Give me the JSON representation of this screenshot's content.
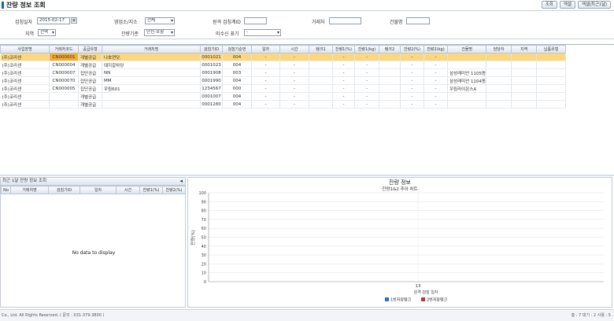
{
  "header": {
    "title": "잔량 정보 조회",
    "buttons": [
      "조회",
      "엑셀",
      "엑셀(최근1달)"
    ]
  },
  "filters": {
    "date_label": "검침일자",
    "date_value": "2015-02-17",
    "office_label": "영업소/지소",
    "office_value": "전체",
    "meter_label": "원격 검침계ID",
    "meter_value": "",
    "client_label": "거래처",
    "client_value": "",
    "building_label": "건물명",
    "building_value": "",
    "region_label": "지역",
    "region_value": "전역",
    "remain_label": "잔량기준",
    "remain_value": "단선-포함",
    "unreceived_label": "미수신 표기",
    "unreceived_value": "-"
  },
  "main_grid": {
    "columns": [
      "사업장명",
      "거래처코드",
      "공급유형",
      "거래처명",
      "검침기ID",
      "검침기순번",
      "일자",
      "시간",
      "탱크1",
      "잔량1(%)",
      "잔량1(kg)",
      "탱크2",
      "잔량2(%)",
      "잔량2(kg)",
      "건물명",
      "담당자",
      "지역",
      "납품유형"
    ],
    "rows": [
      [
        "(주)코리센",
        "CN000001",
        "개별공급",
        "나호연닷.",
        "0001021",
        "004",
        "-",
        "-",
        "",
        "-",
        "-",
        "",
        "-",
        "-",
        "",
        "",
        "",
        ""
      ],
      [
        "(주)코리센",
        "CN000004",
        "개별공급",
        "돼지갈차당",
        "0001023",
        "004",
        "-",
        "-",
        "",
        "-",
        "-",
        "",
        "-",
        "-",
        "",
        "",
        "",
        ""
      ],
      [
        "(주)코리센",
        "CN000007",
        "집단공급",
        "NN",
        "0001908",
        "003",
        "-",
        "-",
        "",
        "-",
        "-",
        "",
        "-",
        "-",
        "삼성래미안 1105동",
        "",
        "",
        ""
      ],
      [
        "(주)코리센",
        "CN000070",
        "집단공급",
        "MM",
        "0001990",
        "004",
        "-",
        "-",
        "",
        "-",
        "-",
        "",
        "-",
        "-",
        "삼성래미안 1104동",
        "",
        "",
        ""
      ],
      [
        "(주)코리센",
        "CN000005",
        "집단공급",
        "우림601",
        "1234567",
        "000",
        "-",
        "-",
        "",
        "-",
        "-",
        "",
        "-",
        "-",
        "우림라이온스A",
        "",
        "",
        ""
      ],
      [
        "(주)코리센",
        "",
        "개별공급",
        "",
        "0001007",
        "004",
        "-",
        "-",
        "",
        "-",
        "-",
        "",
        "-",
        "-",
        "",
        "",
        "",
        ""
      ],
      [
        "(주)코리센",
        "",
        "개별공급",
        "",
        "0001280",
        "004",
        "-",
        "-",
        "",
        "-",
        "-",
        "",
        "-",
        "-",
        "",
        "",
        "",
        ""
      ]
    ]
  },
  "left_panel": {
    "title": "최근 1달 잔량 정보 조회",
    "columns": [
      "No",
      "거래처명",
      "검침기ID",
      "일자",
      "시간",
      "잔량1(%)",
      "잔량2(%)"
    ],
    "empty_text": "No data to display"
  },
  "chart_data": {
    "type": "bar",
    "title": "잔량 정보",
    "subtitle": "잔량1&2 추이 차트",
    "categories": [
      "13"
    ],
    "series": [
      {
        "name": "1번저장탱크",
        "values": [
          0
        ]
      },
      {
        "name": "2번저장탱크",
        "values": [
          0
        ]
      }
    ],
    "xlabel": "원격 검침 일자",
    "ylabel": "잔량(%)",
    "ylim": [
      0,
      100
    ],
    "yticks": [
      0,
      10,
      20,
      30,
      40,
      50,
      60,
      70,
      80,
      90,
      100
    ],
    "grid": true,
    "legend_position": "bottom",
    "series_colors": [
      "#2b6fd1",
      "#b03a3a"
    ]
  },
  "status": {
    "copyright": "Co., Ltd. All Rights Reserved. ( 문의 : 031-379-3800 )",
    "counts": "총 : 7  대기 : 2  사용 : 5"
  }
}
